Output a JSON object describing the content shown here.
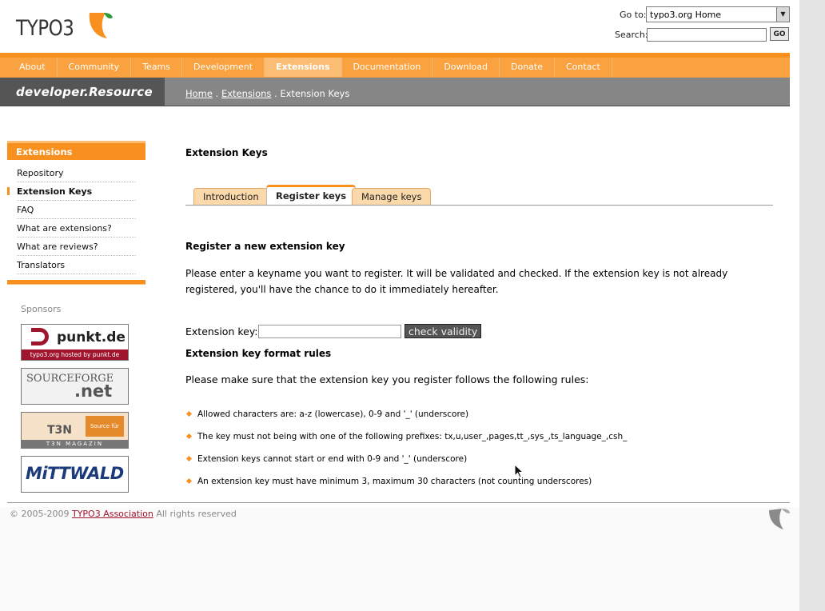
{
  "header": {
    "logo_text": "TYPO3",
    "goto_label": "Go to:",
    "goto_value": "typo3.org Home",
    "search_label": "Search:",
    "search_value": "",
    "go_button": "GO"
  },
  "nav": {
    "items": [
      "About",
      "Community",
      "Teams",
      "Development",
      "Extensions",
      "Documentation",
      "Download",
      "Donate",
      "Contact"
    ],
    "active": "Extensions"
  },
  "devbar": {
    "title": "developer.Resource",
    "crumbs": [
      "Home",
      "Extensions",
      "Extension Keys"
    ],
    "separator": "."
  },
  "sidebar": {
    "heading": "Extensions",
    "items": [
      {
        "label": "Repository",
        "active": false
      },
      {
        "label": "Extension Keys",
        "active": true
      },
      {
        "label": "FAQ",
        "active": false
      },
      {
        "label": "What are extensions?",
        "active": false
      },
      {
        "label": "What are reviews?",
        "active": false
      },
      {
        "label": "Translators",
        "active": false
      }
    ]
  },
  "sponsors": {
    "label": "Sponsors",
    "items": [
      {
        "name": "punkt.de",
        "tagline": "typo3.org hosted by punkt.de"
      },
      {
        "name": "SOURCEFORGE",
        "suffix": ".net"
      },
      {
        "name": "T3N",
        "tagline": "T3N MAGAZIN",
        "badge": "Source für"
      },
      {
        "name": "MiTTWALD"
      }
    ]
  },
  "main": {
    "title": "Extension Keys",
    "tabs": [
      {
        "label": "Introduction",
        "active": false
      },
      {
        "label": "Register keys",
        "active": true
      },
      {
        "label": "Manage keys",
        "active": false
      }
    ],
    "register_heading": "Register a new extension key",
    "register_text": "Please enter a keyname you want to register. It will be validated and checked. If the extension key is not already registered, you'll have the chance to do it immediately hereafter.",
    "key_label": "Extension key:",
    "key_value": "",
    "check_button": "check validity",
    "rules_heading": "Extension key format rules",
    "rules_intro": "Please make sure that the extension key you register follows the following rules:",
    "rules": [
      "Allowed characters are: a-z (lowercase), 0-9 and '_' (underscore)",
      "The key must not being with one of the following prefixes: tx,u,user_,pages,tt_,sys_,ts_language_,csh_",
      "Extension keys cannot start or end with 0-9 and '_' (underscore)",
      "An extension key must have minimum 3, maximum 30 characters (not counting underscores)"
    ]
  },
  "footer": {
    "copyright": "© 2005-2009",
    "association": "TYPO3 Association",
    "rights": "All rights reserved"
  },
  "colors": {
    "accent": "#f7901e",
    "nav_bg": "#f9a23f",
    "devbar_bg": "#868686",
    "devbar_dark": "#555555",
    "link_red": "#a0142d"
  }
}
